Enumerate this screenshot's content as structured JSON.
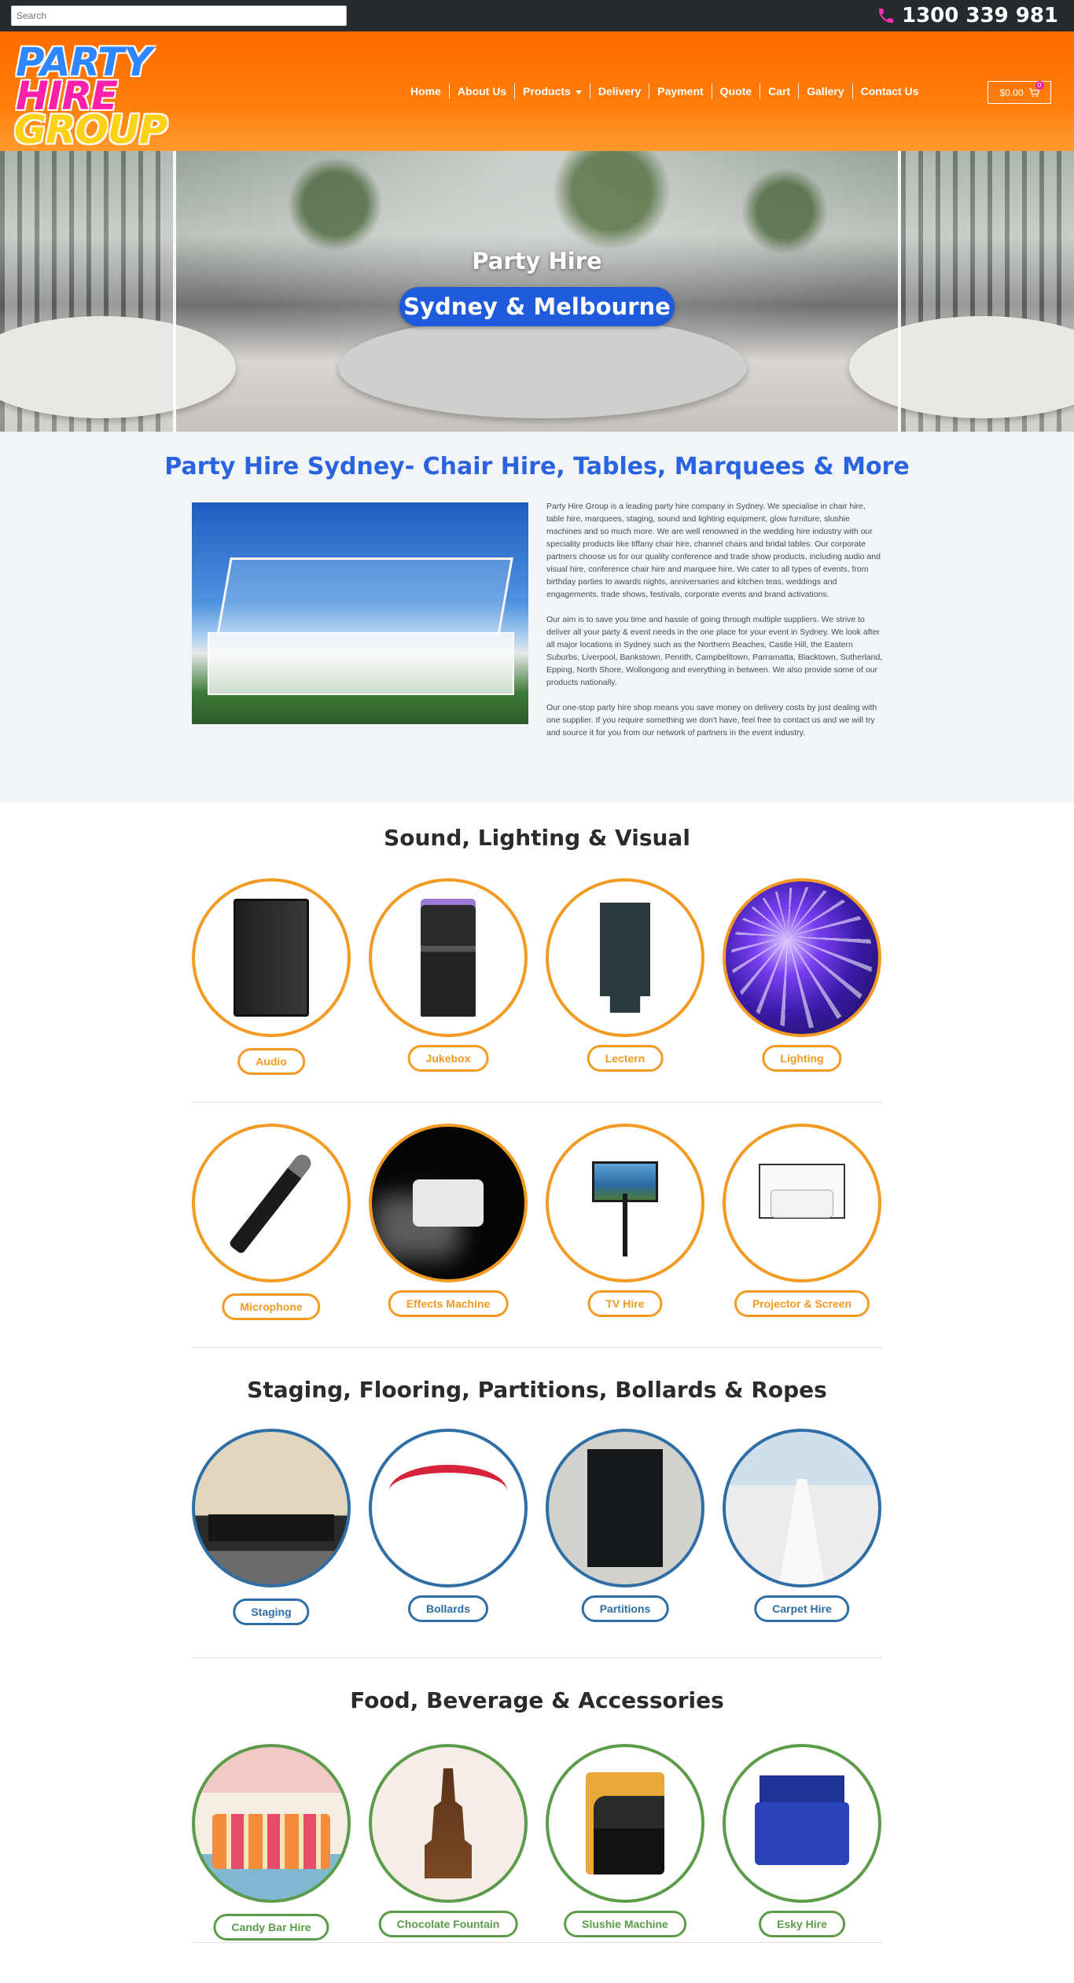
{
  "topbar": {
    "search_placeholder": "Search",
    "phone": "1300 339 981"
  },
  "header": {
    "logo_line1": "PARTY",
    "logo_line2": "HIRE",
    "logo_line3": "GROUP",
    "nav": [
      "Home",
      "About Us",
      "Products",
      "Delivery",
      "Payment",
      "Quote",
      "Cart",
      "Gallery",
      "Contact Us"
    ],
    "cart_total": "$0.00",
    "cart_count": "0"
  },
  "hero": {
    "kicker": "Party Hire",
    "pill": "Sydney & Melbourne"
  },
  "intro": {
    "title": "Party Hire Sydney- Chair Hire, Tables, Marquees & More",
    "paragraphs": [
      "Party Hire Group is a leading party hire company in Sydney. We specialise in chair hire, table hire, marquees, staging, sound and lighting equipment, glow furniture, slushie machines and so much more. We are well renowned in the wedding hire industry with our speciality products like tiffany chair hire, channel chairs and bridal tables. Our corporate partners choose us for our quality conference and trade show products, including audio and visual hire, conference chair hire and marquee hire. We cater to all types of events, from birthday parties to awards nights, anniversaries and kitchen teas, weddings and engagements, trade shows, festivals, corporate events and brand activations.",
      "Our aim is to save you time and hassle of going through multiple suppliers. We strive to deliver all your party & event needs in the one place for your event in Sydney. We look after all major locations in Sydney such as the Northern Beaches, Castle Hill, the Eastern Suburbs, Liverpool, Bankstown, Penrith, Campbelltown, Parramatta, Blacktown, Sutherland, Epping, North Shore, Wollongong and everything in between. We also provide some of our products nationally.",
      "Our one-stop party hire shop means you save money on delivery costs by just dealing with one supplier. If you require something we don't have, feel free to contact us and we will try and source it for you from our network of partners in the event industry."
    ]
  },
  "sections": {
    "sound": {
      "title": "Sound, Lighting & Visual",
      "row1": [
        "Audio",
        "Jukebox",
        "Lectern",
        "Lighting"
      ],
      "row2": [
        "Microphone",
        "Effects Machine",
        "TV Hire",
        "Projector & Screen"
      ]
    },
    "staging": {
      "title": "Staging, Flooring, Partitions, Bollards & Ropes",
      "items": [
        "Staging",
        "Bollards",
        "Partitions",
        "Carpet Hire"
      ]
    },
    "food": {
      "title": "Food, Beverage & Accessories",
      "items": [
        "Candy Bar Hire",
        "Chocolate Fountain",
        "Slushie Machine",
        "Esky Hire"
      ]
    }
  },
  "colors": {
    "orange": "#ff6a00",
    "accent_orange": "#f39a22",
    "blue": "#2a63e0",
    "staging_blue": "#2e6ea6",
    "food_green": "#5b9b4a"
  }
}
